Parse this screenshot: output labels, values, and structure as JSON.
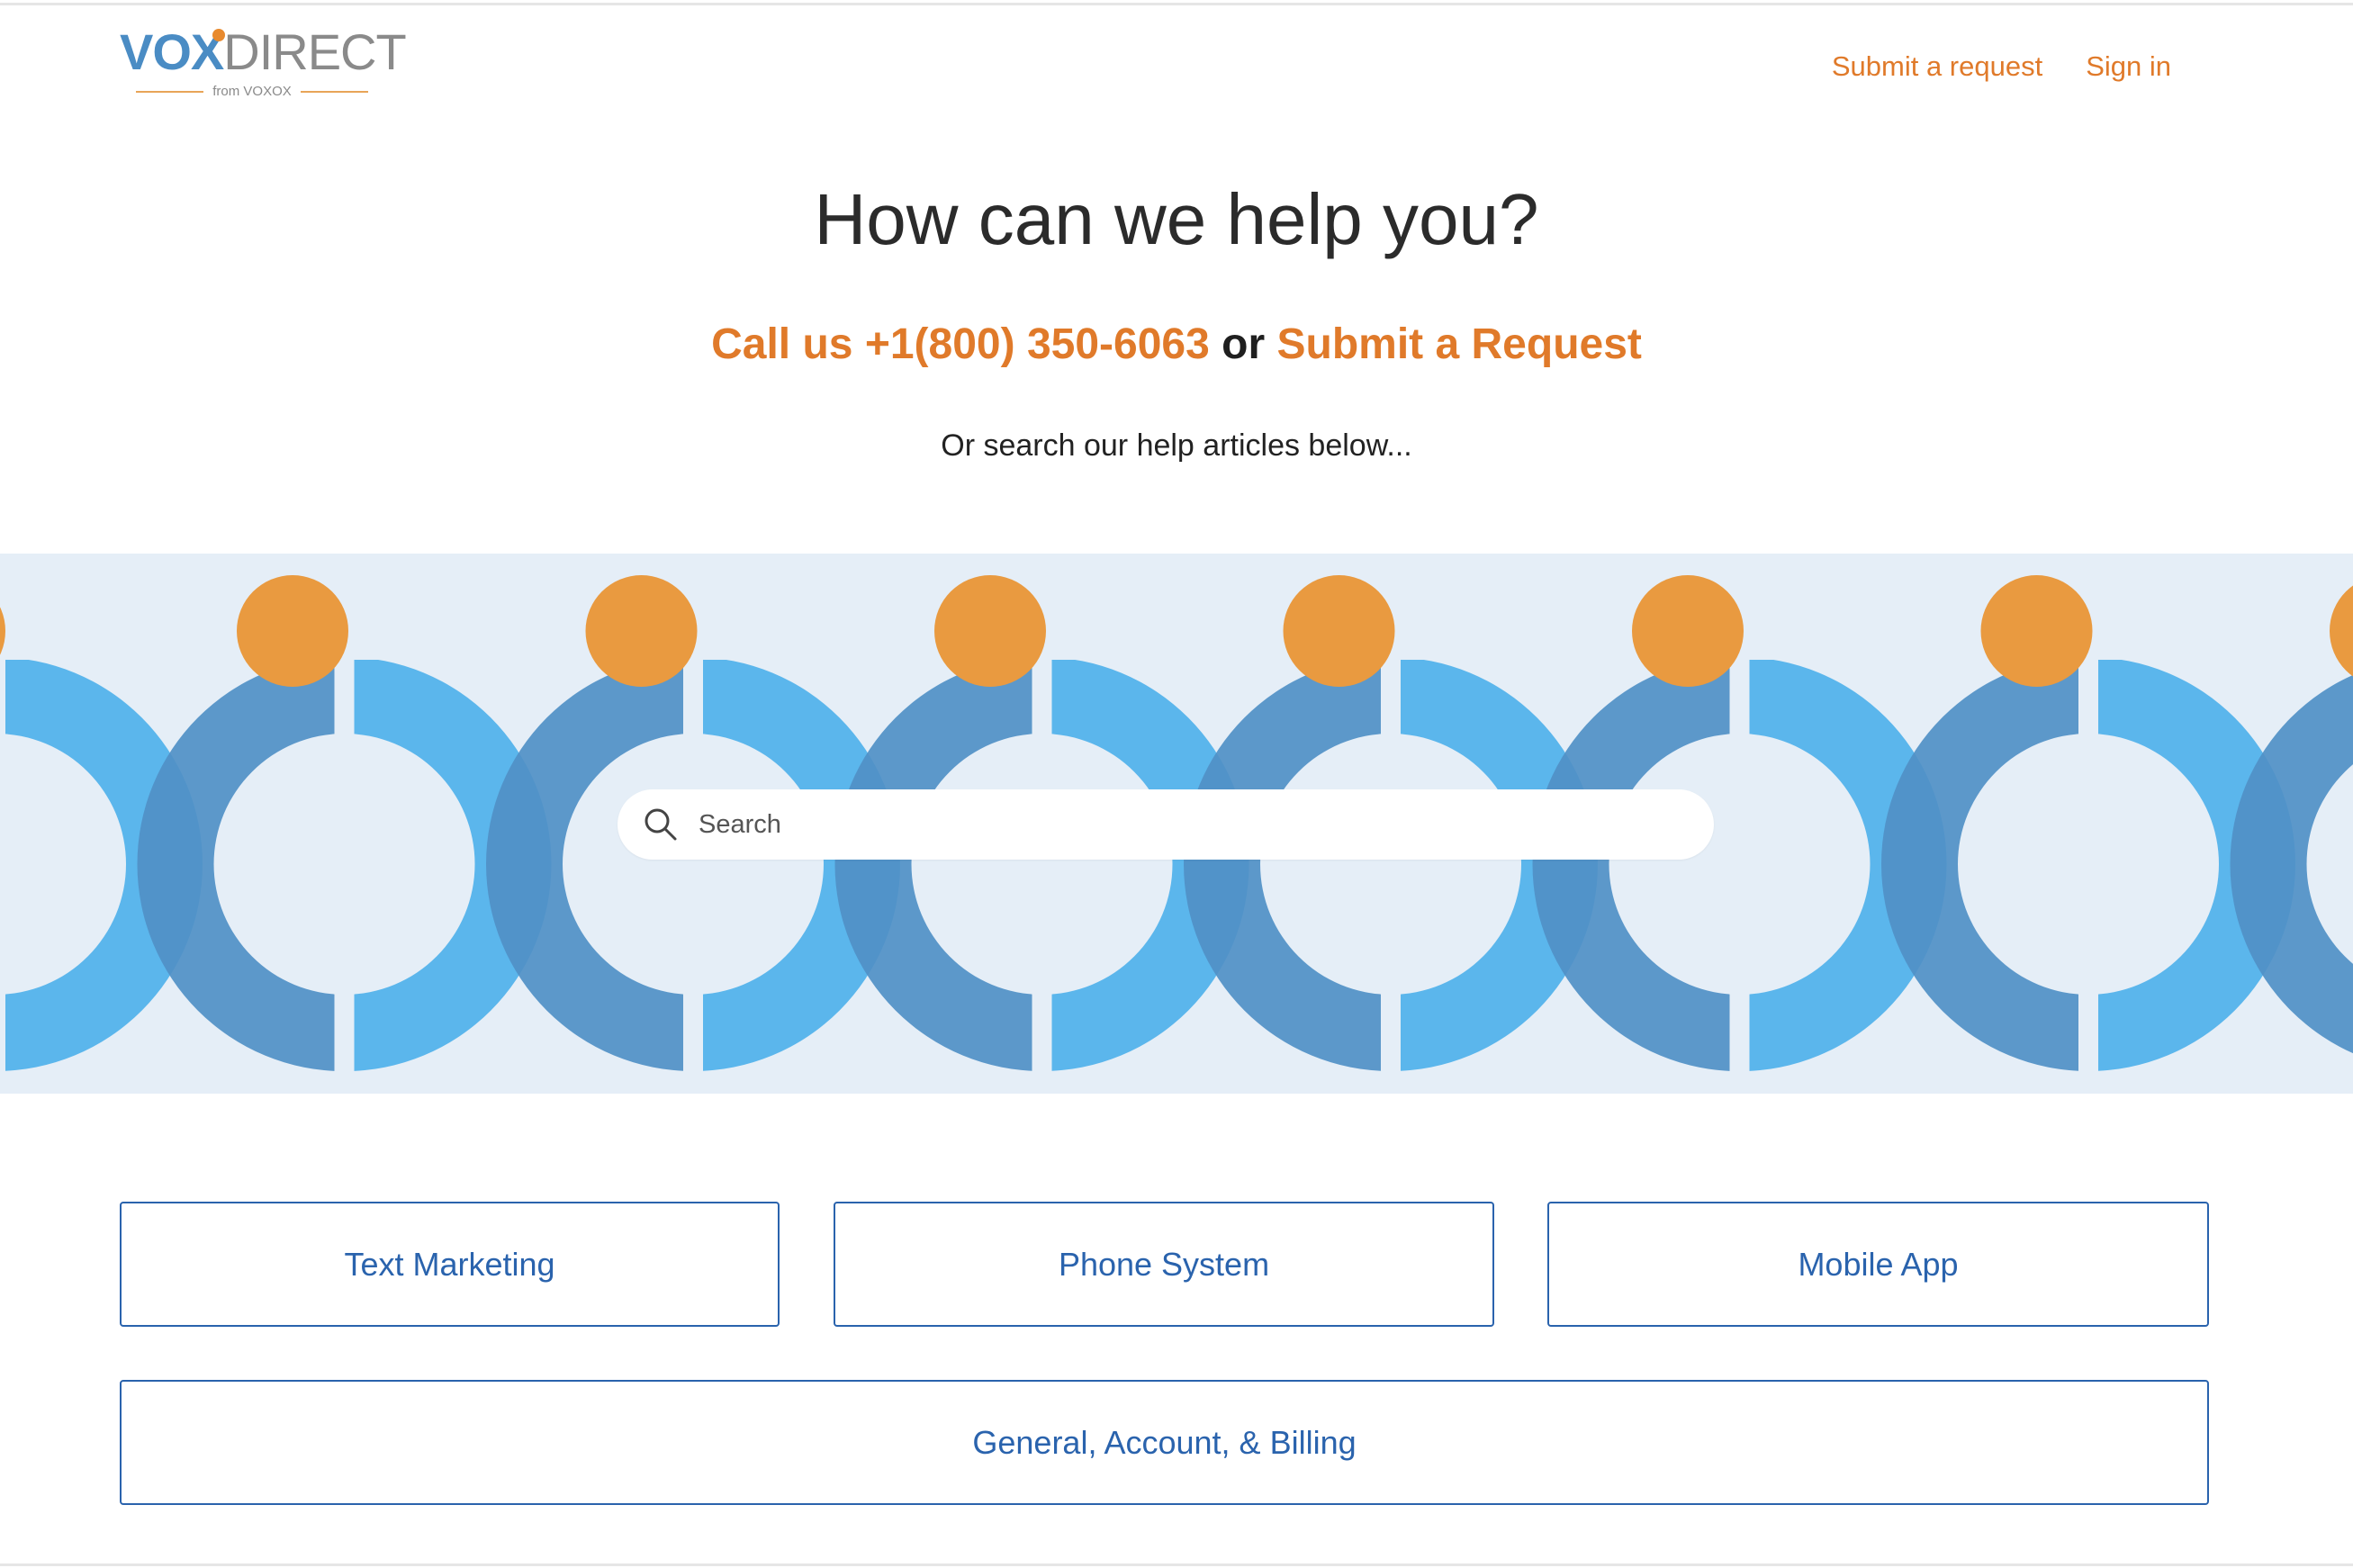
{
  "brand": {
    "logo_primary": "VOX",
    "logo_secondary": "DIRECT",
    "logo_sub": "from VOXOX",
    "colors": {
      "orange": "#e07a2a",
      "blue_dark": "#2a63ad",
      "blue_light": "#4fb1ea",
      "blue_mid": "#5090c5",
      "banner_bg": "#e5eef7"
    }
  },
  "nav": {
    "submit_request": "Submit a request",
    "sign_in": "Sign in"
  },
  "hero": {
    "title": "How can we help you?",
    "call_us": "Call us +1(800) 350-6063",
    "or": "or",
    "submit_request": "Submit a Request",
    "subtitle": "Or search our help articles below..."
  },
  "search": {
    "placeholder": "Search",
    "value": "",
    "icon": "search-icon"
  },
  "categories": [
    {
      "label": "Text Marketing"
    },
    {
      "label": "Phone System"
    },
    {
      "label": "Mobile App"
    },
    {
      "label": "General, Account, & Billing"
    }
  ]
}
